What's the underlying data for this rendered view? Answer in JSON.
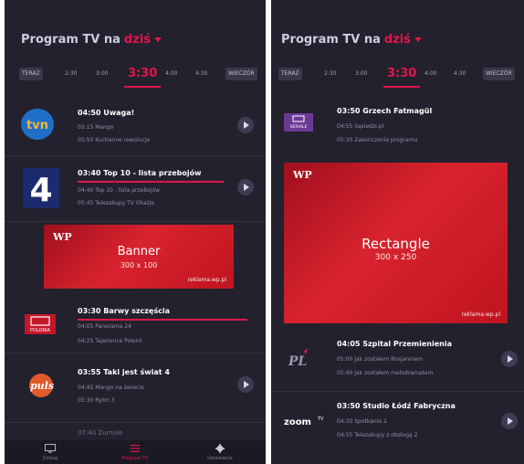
{
  "colors": {
    "accent": "#e2164a",
    "background": "#23212e",
    "text": "#ffffff",
    "muted": "#8f8da3"
  },
  "left": {
    "header": {
      "title": "Program TV na",
      "day": "dziś"
    },
    "tabs": [
      "TERAZ",
      "2:30",
      "3:00",
      "3:30",
      "4:00",
      "4:30",
      "WIECZÓR"
    ],
    "active_tab": "3:30",
    "rows": [
      {
        "channel": "TVN",
        "logo_icon": "tvn-logo-icon",
        "title": "04:50 Uwaga!",
        "next": [
          "05:15 Mango",
          "05:50 Kuchenne rewolucje"
        ],
        "progress": 0
      },
      {
        "channel": "TV4",
        "logo_icon": "tv4-logo-icon",
        "title": "03:40 Top 10 - lista przebojów",
        "next": [
          "04:40 Top 10 - lista przebojów",
          "05:45 Telezakupy TV Okazje"
        ],
        "progress": 0.85
      },
      {
        "channel": "TV Polonia",
        "logo_icon": "tvp-polonia-logo-icon",
        "title": "03:30 Barwy szczęścia",
        "next": [
          "04:05 Panorama 24",
          "04:25 Tajemnice Polonii"
        ],
        "progress": 0.95
      },
      {
        "channel": "TV Puls",
        "logo_icon": "tv-puls-logo-icon",
        "title": "03:55 Taki jest świat 4",
        "next": [
          "04:45 Mango na świecie",
          "05:30 Rytm 3"
        ],
        "progress": 0
      }
    ],
    "partial_row": "07:40 Żurnale",
    "ad": {
      "brand": "WP",
      "label": "Banner",
      "size": "300 x 100",
      "footer": "reklama.wp.pl"
    },
    "nav": [
      {
        "label": "Dzisiaj",
        "icon": "tv-icon"
      },
      {
        "label": "Program TV",
        "icon": "list-icon"
      },
      {
        "label": "Ustawienia",
        "icon": "gear-icon"
      }
    ],
    "active_nav": "Program TV"
  },
  "right": {
    "header": {
      "title": "Program TV na",
      "day": "dziś"
    },
    "tabs": [
      "TERAZ",
      "2:30",
      "3:00",
      "3:30",
      "4:00",
      "4:30",
      "WIECZÓR"
    ],
    "active_tab": "3:30",
    "rows": [
      {
        "channel": "TVP Seriale",
        "logo_icon": "tvp-seriale-logo-icon",
        "title": "03:50 Grzech Fatmagül",
        "next": [
          "04:55 Sąsiedzi.pl",
          "05:30 Zakończenie programu"
        ],
        "progress": 0
      },
      {
        "channel": "Polsat 1",
        "logo_icon": "polsat-logo-icon",
        "title": "04:05 Szpital Przemienienia",
        "next": [
          "05:00 Jak zostałem Rosjaninem",
          "05:40 Jak zostałem melodramatem"
        ],
        "progress": 0
      },
      {
        "channel": "Zoom TV",
        "logo_icon": "zoom-logo-icon",
        "title": "03:50 Studio Łódź Fabryczna",
        "next": [
          "04:30 Spotkanie 2",
          "04:55 Telezakupy z obsługą 2"
        ],
        "progress": 0
      }
    ],
    "ad": {
      "brand": "WP",
      "label": "Rectangle",
      "size": "300 x 250",
      "footer": "reklama.wp.pl"
    }
  }
}
